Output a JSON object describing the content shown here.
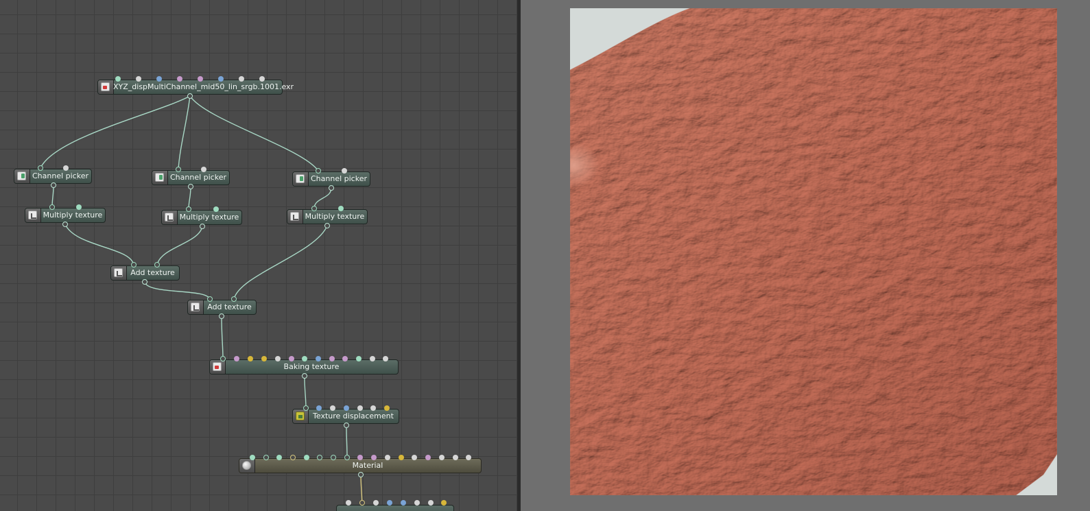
{
  "graph": {
    "nodes": {
      "source": "XYZ_dispMultiChannel_mid50_lin_srgb.1001.exr",
      "channel_picker_1": "Channel picker",
      "channel_picker_2": "Channel picker",
      "channel_picker_3": "Channel picker",
      "multiply_1": "Multiply texture",
      "multiply_2": "Multiply texture",
      "multiply_3": "Multiply texture",
      "add_1": "Add texture",
      "add_2": "Add texture",
      "baking": "Baking texture",
      "displacement": "Texture displacement",
      "material": "Material"
    },
    "icons": {
      "image": "image-texture-icon",
      "picker": "channel-picker-icon",
      "operation": "texture-operation-icon",
      "displacement": "displacement-icon",
      "material": "material-sphere-icon"
    },
    "colors": {
      "background": "#4a4a4a",
      "grid": "#3e3e3e",
      "texture_node": "#4e5f59",
      "material_node": "#5e5c4c",
      "wire_texture": "#a9d8c6",
      "wire_material": "#d7c780",
      "port_green": "#9fdcc0",
      "port_white": "#d6d6d6",
      "port_blue": "#7aa4d6",
      "port_pink": "#c69acb",
      "port_yellow": "#d7b73a"
    }
  },
  "viewer": {
    "content": "rendered-skin-displacement-preview",
    "colors": {
      "skin_base": "#d09080",
      "skin_highlight": "#e6b4a4",
      "skin_shadow": "#8e5a4e",
      "backdrop": "#d4dad8"
    }
  }
}
